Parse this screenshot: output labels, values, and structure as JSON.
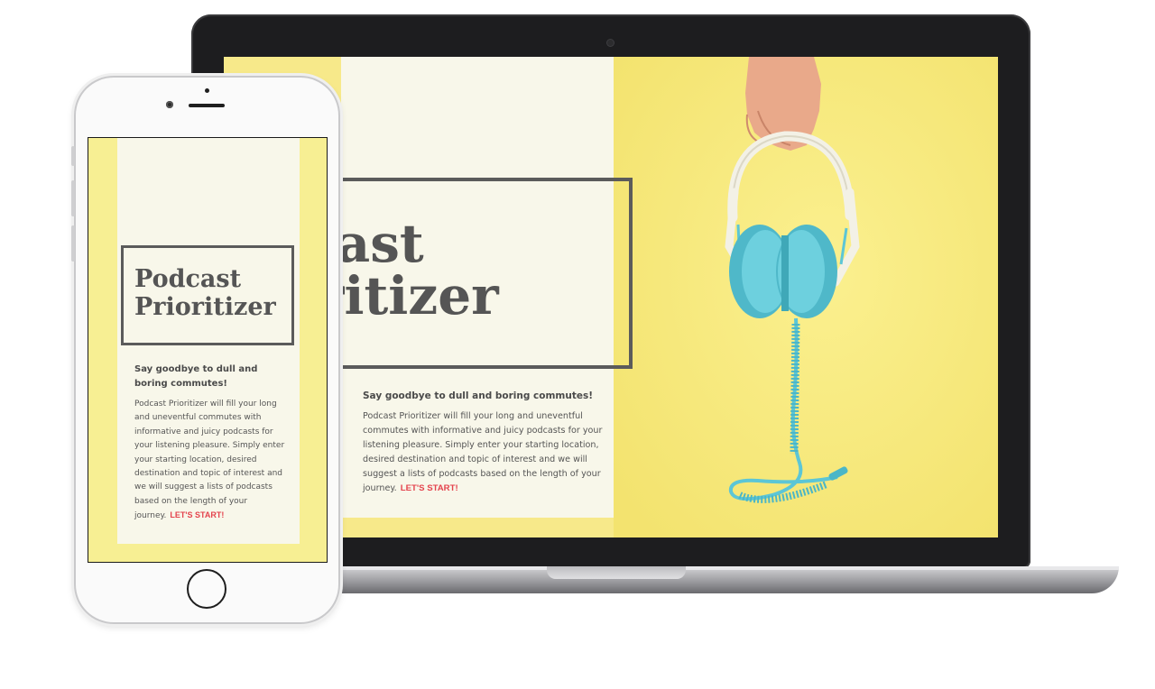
{
  "site": {
    "title_line1": "Podcast",
    "title_line2": "Prioritizer",
    "heading": "Say goodbye to dull and boring commutes!",
    "body": "Podcast Prioritizer will fill your long and uneventful commutes with informative and juicy podcasts for your listening pleasure. Simply enter your starting location, desired destination and topic of interest and we will suggest a lists of podcasts based on the length of your journey.",
    "cta": "LET'S START!"
  },
  "colors": {
    "background_yellow": "#f7e98a",
    "panel_cream": "#f8f7ea",
    "title_gray": "#555555",
    "cta_red": "#e4434d",
    "headphone_teal": "#5cc6d6"
  },
  "icons": {
    "hero_illustration": "headphones-held-by-hand"
  }
}
